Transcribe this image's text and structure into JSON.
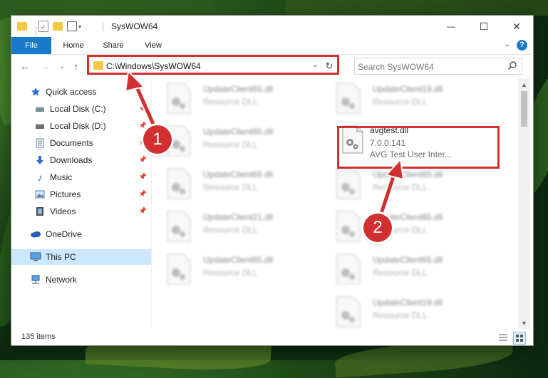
{
  "window": {
    "title": "SysWOW64",
    "controls": {
      "minimize": "—",
      "maximize": "☐",
      "close": "✕"
    }
  },
  "ribbon": {
    "tabs": [
      "File",
      "Home",
      "Share",
      "View"
    ],
    "help": "?"
  },
  "navigation": {
    "address_path": "C:\\Windows\\SysWOW64",
    "search_placeholder": "Search SysWOW64"
  },
  "sidebar": {
    "items": [
      {
        "label": "Quick access",
        "icon": "star-icon"
      },
      {
        "label": "Local Disk (C:)",
        "icon": "drive-icon"
      },
      {
        "label": "Local Disk (D:)",
        "icon": "drive-icon"
      },
      {
        "label": "Documents",
        "icon": "document-icon"
      },
      {
        "label": "Downloads",
        "icon": "download-icon"
      },
      {
        "label": "Music",
        "icon": "music-icon"
      },
      {
        "label": "Pictures",
        "icon": "pictures-icon"
      },
      {
        "label": "Videos",
        "icon": "videos-icon"
      },
      {
        "label": "OneDrive",
        "icon": "cloud-icon"
      },
      {
        "label": "This PC",
        "icon": "computer-icon",
        "selected": true
      },
      {
        "label": "Network",
        "icon": "network-icon"
      }
    ]
  },
  "files": {
    "highlighted": {
      "name": "avgtest.dll",
      "version": "7.0.0.141",
      "description": "AVG Test User Inter..."
    },
    "background_tiles": [
      {
        "name": "UpdateClient65.dll",
        "type": "Resource DLL"
      },
      {
        "name": "UpdateClient19.dll",
        "type": "Resource DLL"
      },
      {
        "name": "UpdateClient65.dll",
        "type": "Resource DLL"
      },
      {
        "name": "UpdateClient65.dll",
        "type": "Resource DLL"
      },
      {
        "name": "UpdateClient65.dll",
        "type": "Resource DLL"
      },
      {
        "name": "UpdateClient21.dll",
        "type": "Resource DLL"
      },
      {
        "name": "UpdateClient65.dll",
        "type": "Resource DLL"
      },
      {
        "name": "UpdateClient65.dll",
        "type": "Resource DLL"
      },
      {
        "name": "UpdateClient65.dll",
        "type": "Resource DLL"
      },
      {
        "name": "UpdateClient19.dll",
        "type": "Resource DLL"
      }
    ]
  },
  "status": {
    "item_count": "135 items"
  },
  "annotations": {
    "step1": "1",
    "step2": "2"
  },
  "colors": {
    "accent": "#1979ca",
    "highlight": "#d0302f",
    "selected": "#cce8ff"
  }
}
